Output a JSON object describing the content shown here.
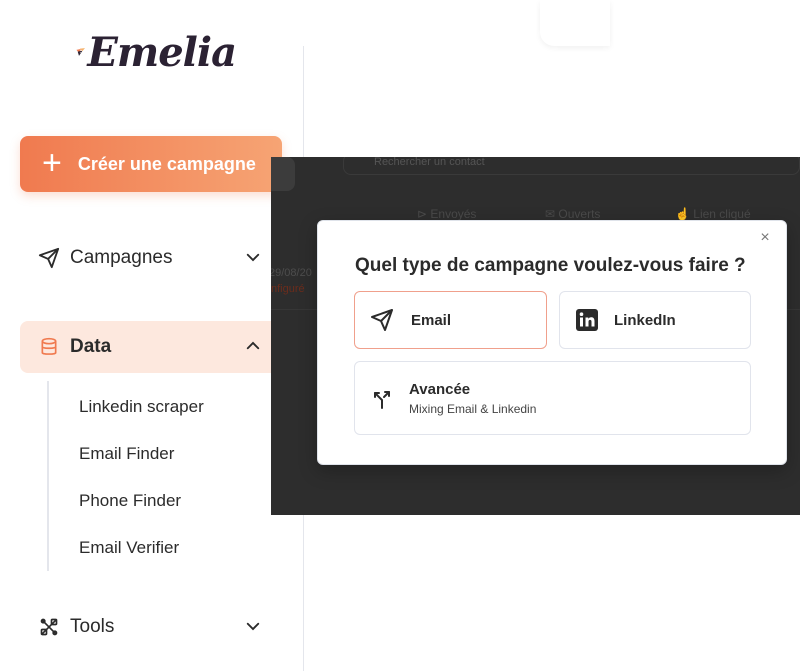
{
  "brand": {
    "name": "Emelia",
    "accent": "#f07a4f",
    "accent_light": "#fde8de",
    "dark": "#2b2233"
  },
  "sidebar": {
    "create_button": {
      "icon": "plus-icon",
      "label": "Créer une campagne"
    },
    "items": [
      {
        "label": "Campagnes",
        "icon": "send-icon",
        "chevron": "chevron-down-icon"
      },
      {
        "label": "Data",
        "icon": "database-icon",
        "chevron": "chevron-up-icon",
        "active": true,
        "children": [
          "Linkedin scraper",
          "Email Finder",
          "Phone Finder",
          "Email Verifier"
        ]
      },
      {
        "label": "Tools",
        "icon": "tools-icon",
        "chevron": "chevron-down-icon"
      }
    ]
  },
  "background": {
    "search_placeholder": "Rechercher un contact",
    "columns": [
      "Envoyés",
      "Ouverts",
      "Lien cliqué"
    ],
    "row_date": "29/08/20",
    "row_status": "nfiguré"
  },
  "modal": {
    "title": "Quel type de campagne voulez-vous faire ?",
    "close_icon": "close-icon",
    "options": [
      {
        "label": "Email",
        "icon": "send-icon",
        "selected": true
      },
      {
        "label": "LinkedIn",
        "icon": "linkedin-icon"
      },
      {
        "label": "Avancée",
        "subtitle": "Mixing Email & Linkedin",
        "icon": "split-arrows-icon"
      }
    ]
  }
}
